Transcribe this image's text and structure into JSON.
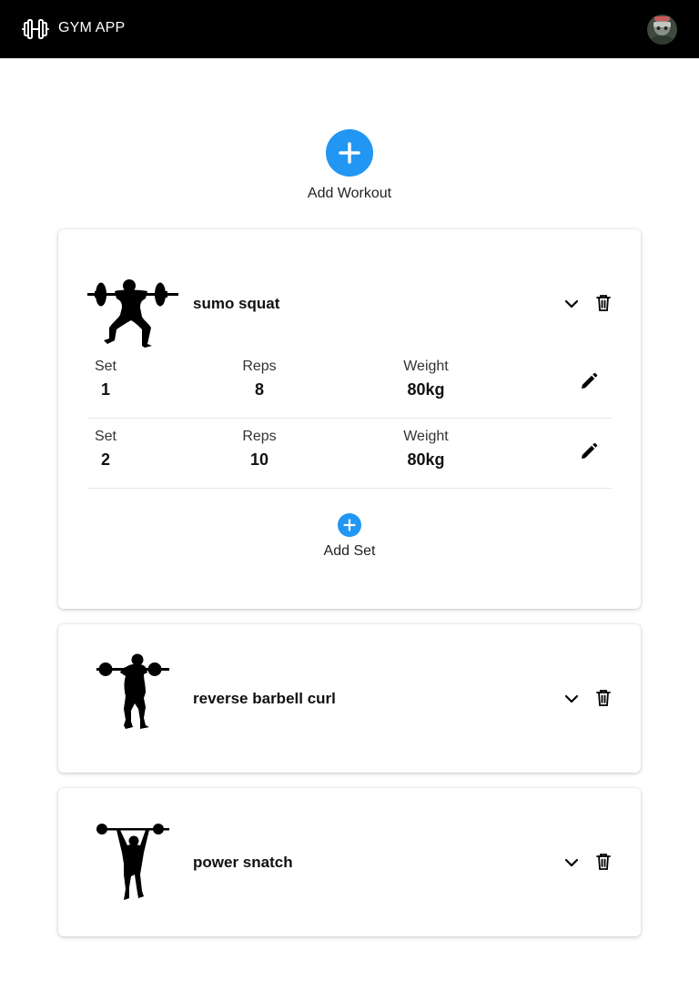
{
  "header": {
    "title": "GYM APP",
    "brand_icon": "dumbbell-icon",
    "avatar": "user-avatar"
  },
  "add_workout": {
    "label": "Add Workout",
    "icon": "plus-icon"
  },
  "colors": {
    "topbar": "#000000",
    "accent": "#2196f3"
  },
  "exercises": [
    {
      "name": "sumo squat",
      "expanded": true,
      "image": "sumo-squat-silhouette",
      "sets": [
        {
          "set_label": "Set",
          "set": "1",
          "reps_label": "Reps",
          "reps": "8",
          "weight_label": "Weight",
          "weight": "80kg"
        },
        {
          "set_label": "Set",
          "set": "2",
          "reps_label": "Reps",
          "reps": "10",
          "weight_label": "Weight",
          "weight": "80kg"
        }
      ],
      "add_set_label": "Add Set"
    },
    {
      "name": "reverse barbell curl",
      "expanded": false,
      "image": "barbell-curl-silhouette"
    },
    {
      "name": "power snatch",
      "expanded": false,
      "image": "power-snatch-silhouette"
    }
  ]
}
